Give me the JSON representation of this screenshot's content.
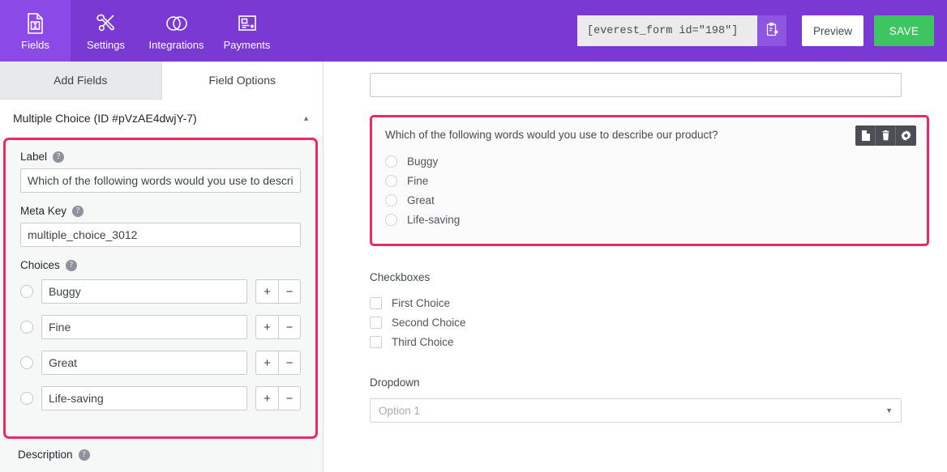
{
  "topnav": {
    "tabs": [
      {
        "label": "Fields",
        "icon": "form-fields-icon",
        "active": true
      },
      {
        "label": "Settings",
        "icon": "tools-icon",
        "active": false
      },
      {
        "label": "Integrations",
        "icon": "venn-circles-icon",
        "active": false
      },
      {
        "label": "Payments",
        "icon": "payment-card-icon",
        "active": false
      }
    ],
    "shortcode_value": "[everest_form id=\"198\"]",
    "copy_icon": "clipboard-copy-icon",
    "preview_label": "Preview",
    "save_label": "SAVE"
  },
  "left_panel": {
    "tabs": [
      {
        "label": "Add Fields",
        "active": false
      },
      {
        "label": "Field Options",
        "active": true
      }
    ],
    "field_header": {
      "title": "Multiple Choice (ID #pVzAE4dwjY-7)",
      "chevron": "▲"
    },
    "label_field": {
      "label": "Label",
      "help": "?",
      "value": "Which of the following words would you use to describe"
    },
    "meta_key_field": {
      "label": "Meta Key",
      "help": "?",
      "value": "multiple_choice_3012"
    },
    "choices_field": {
      "label": "Choices",
      "help": "?",
      "add_label": "+",
      "remove_label": "−",
      "items": [
        {
          "value": "Buggy"
        },
        {
          "value": "Fine"
        },
        {
          "value": "Great"
        },
        {
          "value": "Life-saving"
        }
      ]
    },
    "description_field": {
      "label": "Description",
      "help": "?"
    }
  },
  "preview": {
    "top_input_value": "",
    "multiple_choice": {
      "label": "Which of the following words would you use to describe our product?",
      "toolbar": [
        {
          "icon": "duplicate-icon"
        },
        {
          "icon": "trash-icon"
        },
        {
          "icon": "gear-icon"
        }
      ],
      "options": [
        "Buggy",
        "Fine",
        "Great",
        "Life-saving"
      ]
    },
    "checkboxes": {
      "title": "Checkboxes",
      "options": [
        "First Choice",
        "Second Choice",
        "Third Choice"
      ]
    },
    "dropdown": {
      "title": "Dropdown",
      "value": "Option 1",
      "caret": "▼"
    }
  },
  "colors": {
    "brand_purple": "#7b39d4",
    "active_purple": "#8b4ae8",
    "save_green": "#3fc462",
    "highlight_pink": "#ea2a63"
  }
}
